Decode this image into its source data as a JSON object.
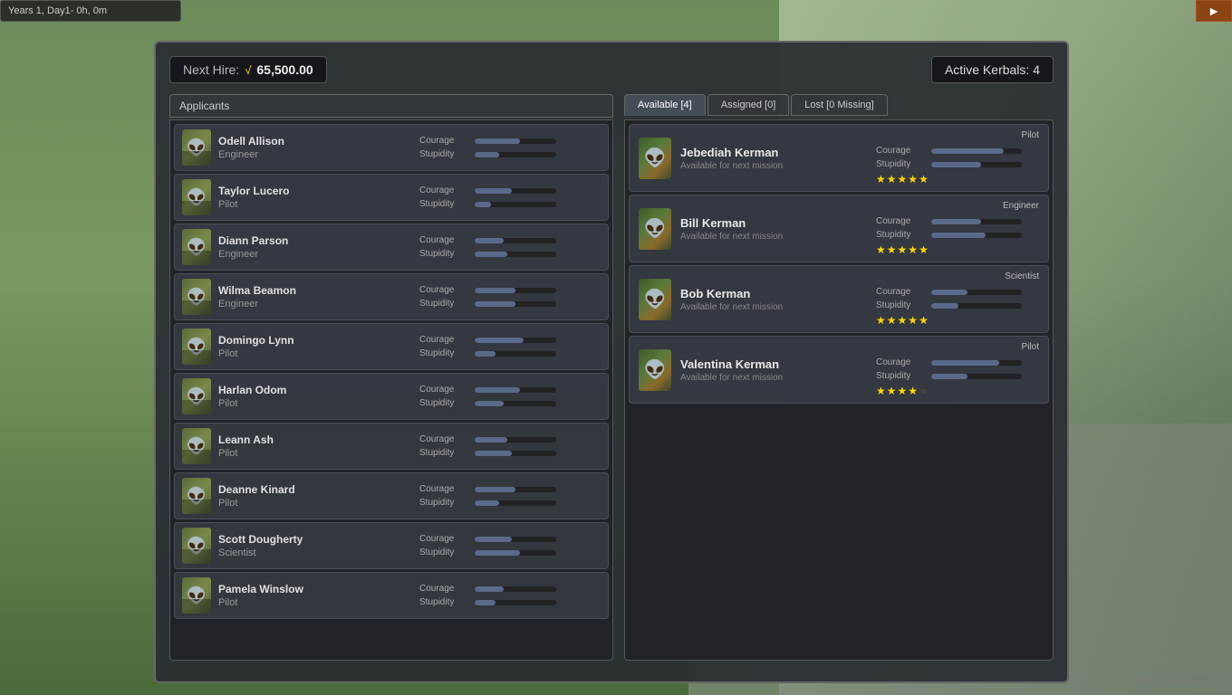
{
  "topbar": {
    "title": "Years 1, Day1- 0h, 0m",
    "exit_icon": "→"
  },
  "hire": {
    "label": "Next Hire:",
    "currency_symbol": "√",
    "amount": "65,500.00"
  },
  "active_header": "Active Kerbals: 4",
  "applicants_header": "Applicants",
  "tabs": [
    {
      "id": "available",
      "label": "Available [4]",
      "active": true
    },
    {
      "id": "assigned",
      "label": "Assigned [0]",
      "active": false
    },
    {
      "id": "lost",
      "label": "Lost [0 Missing]",
      "active": false
    }
  ],
  "applicants": [
    {
      "name": "Odell Allison",
      "role": "Engineer",
      "courage": 55,
      "stupidity": 30
    },
    {
      "name": "Taylor Lucero",
      "role": "Pilot",
      "courage": 45,
      "stupidity": 20
    },
    {
      "name": "Diann Parson",
      "role": "Engineer",
      "courage": 35,
      "stupidity": 40
    },
    {
      "name": "Wilma Beamon",
      "role": "Engineer",
      "courage": 50,
      "stupidity": 50
    },
    {
      "name": "Domingo Lynn",
      "role": "Pilot",
      "courage": 60,
      "stupidity": 25
    },
    {
      "name": "Harlan Odom",
      "role": "Pilot",
      "courage": 55,
      "stupidity": 35
    },
    {
      "name": "Leann Ash",
      "role": "Pilot",
      "courage": 40,
      "stupidity": 45
    },
    {
      "name": "Deanne Kinard",
      "role": "Pilot",
      "courage": 50,
      "stupidity": 30
    },
    {
      "name": "Scott Dougherty",
      "role": "Scientist",
      "courage": 45,
      "stupidity": 55
    },
    {
      "name": "Pamela Winslow",
      "role": "Pilot",
      "courage": 35,
      "stupidity": 25
    }
  ],
  "active_kerbals": [
    {
      "name": "Jebediah Kerman",
      "status": "Available for next mission",
      "role": "Pilot",
      "courage": 80,
      "stupidity": 55,
      "stars": 5
    },
    {
      "name": "Bill Kerman",
      "status": "Available for next mission",
      "role": "Engineer",
      "courage": 55,
      "stupidity": 60,
      "stars": 5
    },
    {
      "name": "Bob Kerman",
      "status": "Available for next mission",
      "role": "Scientist",
      "courage": 40,
      "stupidity": 30,
      "stars": 5
    },
    {
      "name": "Valentina Kerman",
      "status": "Available for next mission",
      "role": "Pilot",
      "courage": 75,
      "stupidity": 40,
      "stars": 4
    }
  ],
  "dev_build": "Development Build",
  "courage_label": "Courage",
  "stupidity_label": "Stupidity"
}
